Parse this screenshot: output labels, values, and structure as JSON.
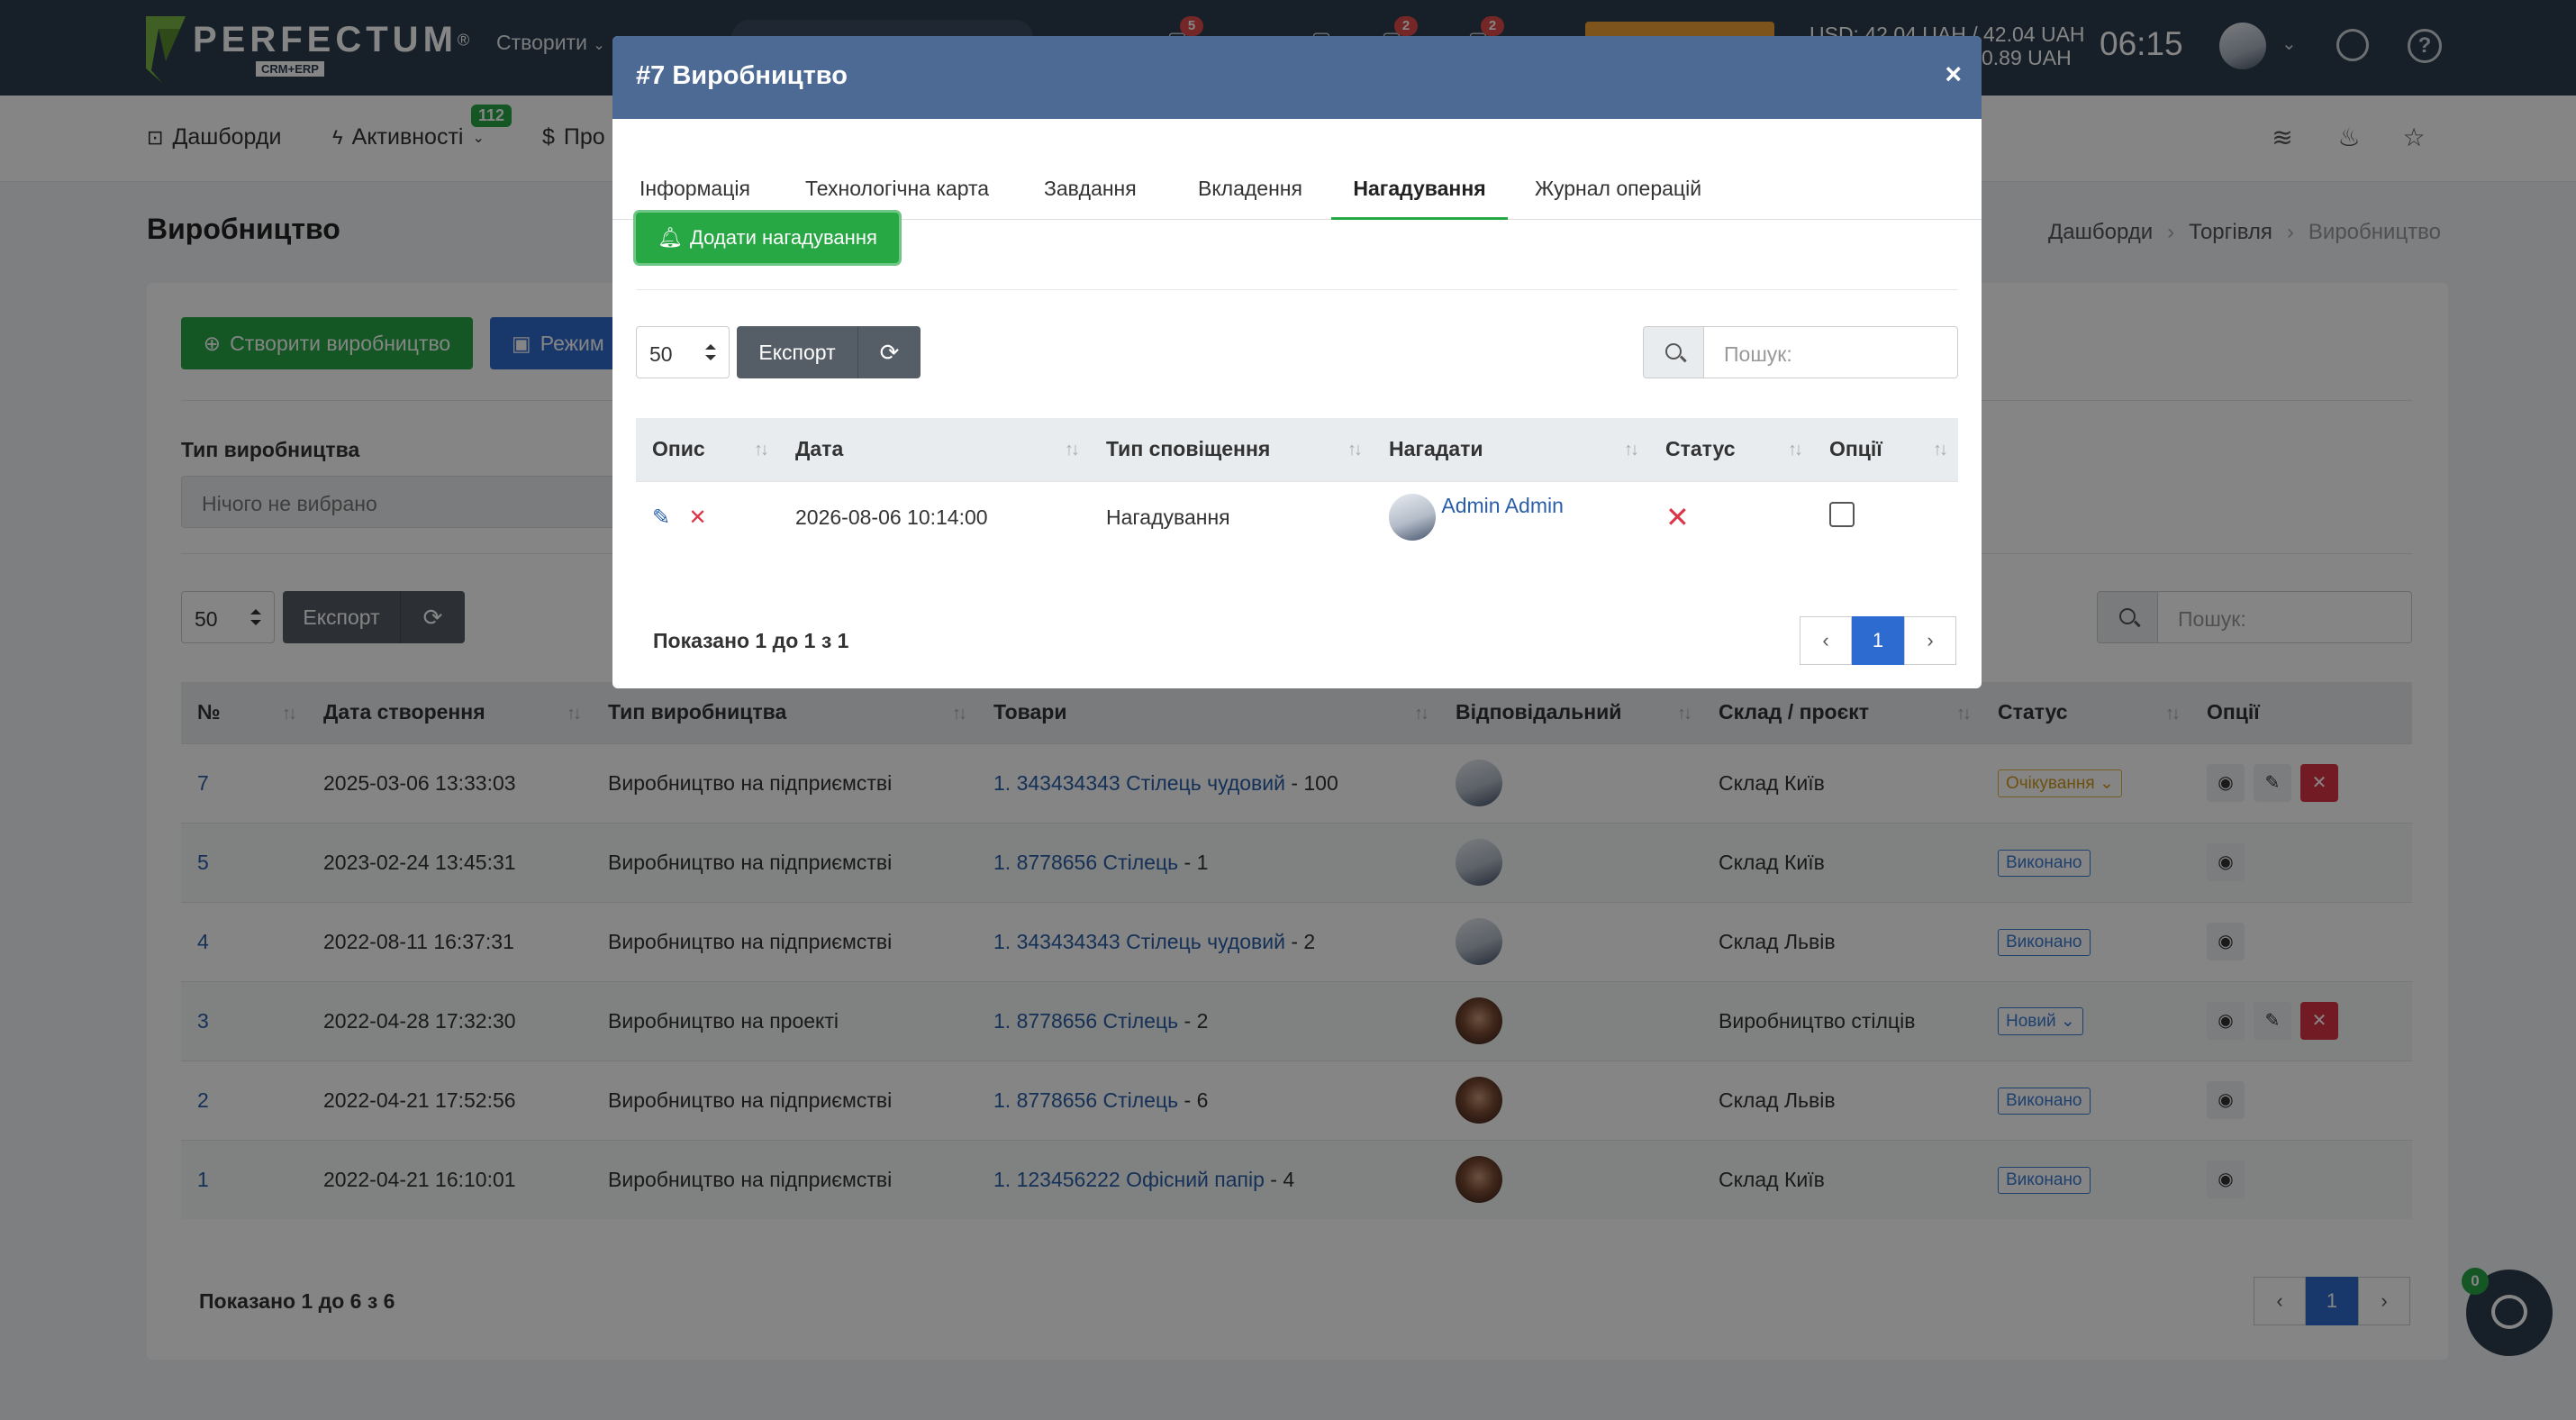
{
  "topbar": {
    "logo_name": "PERFECTUM",
    "logo_reg": "®",
    "logo_sub": "CRM+ERP",
    "create_label": "Створити",
    "badges": [
      "5",
      "2",
      "2"
    ],
    "rates_line1": "USD: 42.04 UAH / 42.04 UAH",
    "rates_line2": "0.89 UAH",
    "clock": "06:15"
  },
  "nav": {
    "items": [
      {
        "label": "Дашборди"
      },
      {
        "label": "Активності",
        "badge": "112"
      },
      {
        "label": "Про"
      }
    ]
  },
  "page": {
    "title": "Виробництво",
    "breadcrumb": [
      "Дашборди",
      "Торгівля",
      "Виробництво"
    ],
    "create_button": "Створити виробництво",
    "mode_button": "Режим",
    "filter_label": "Тип виробництва",
    "filter_placeholder": "Нічого не вибрано",
    "page_size": "50",
    "export_label": "Експорт",
    "search_placeholder": "Пошук:",
    "columns": [
      "№",
      "Дата створення",
      "Тип виробництва",
      "Товари",
      "Відповідальний",
      "Склад / проєкт",
      "Статус",
      "Опції"
    ],
    "rows": [
      {
        "id": "7",
        "date": "2025-03-06 13:33:03",
        "type": "Виробництво на підприємстві",
        "goods_link": "1. 343434343 Стілець чудовий",
        "goods_qty": " - 100",
        "avatar": "man",
        "warehouse": "Склад Київ",
        "status": "Очікування",
        "status_kind": "wait",
        "dropdown": true,
        "edit": true,
        "delete": true
      },
      {
        "id": "5",
        "date": "2023-02-24 13:45:31",
        "type": "Виробництво на підприємстві",
        "goods_link": "1. 8778656 Стілець",
        "goods_qty": " - 1",
        "avatar": "man",
        "warehouse": "Склад Київ",
        "status": "Виконано",
        "status_kind": "done",
        "dropdown": false,
        "edit": false,
        "delete": false
      },
      {
        "id": "4",
        "date": "2022-08-11 16:37:31",
        "type": "Виробництво на підприємстві",
        "goods_link": "1. 343434343 Стілець чудовий",
        "goods_qty": " - 2",
        "avatar": "man",
        "warehouse": "Склад Львів",
        "status": "Виконано",
        "status_kind": "done",
        "dropdown": false,
        "edit": false,
        "delete": false
      },
      {
        "id": "3",
        "date": "2022-04-28 17:32:30",
        "type": "Виробництво на проекті",
        "goods_link": "1. 8778656 Стілець",
        "goods_qty": " - 2",
        "avatar": "woman",
        "warehouse": "Виробництво стілців",
        "status": "Новий",
        "status_kind": "new",
        "dropdown": true,
        "edit": true,
        "delete": true
      },
      {
        "id": "2",
        "date": "2022-04-21 17:52:56",
        "type": "Виробництво на підприємстві",
        "goods_link": "1. 8778656 Стілець",
        "goods_qty": " - 6",
        "avatar": "woman",
        "warehouse": "Склад Львів",
        "status": "Виконано",
        "status_kind": "done",
        "dropdown": false,
        "edit": false,
        "delete": false
      },
      {
        "id": "1",
        "date": "2022-04-21 16:10:01",
        "type": "Виробництво на підприємстві",
        "goods_link": "1. 123456222 Офісний папір",
        "goods_qty": " - 4",
        "avatar": "woman",
        "warehouse": "Склад Київ",
        "status": "Виконано",
        "status_kind": "done",
        "dropdown": false,
        "edit": false,
        "delete": false
      }
    ],
    "shown_text": "Показано 1 до 6 з 6",
    "current_page": "1"
  },
  "modal": {
    "title": "#7 Виробництво",
    "close": "×",
    "tabs": [
      "Інформація",
      "Технологічна карта",
      "Завдання",
      "Вкладення",
      "Нагадування",
      "Журнал операцій"
    ],
    "active_tab": "Нагадування",
    "add_button": "Додати нагадування",
    "page_size": "50",
    "export_label": "Експорт",
    "search_placeholder": "Пошук:",
    "columns": [
      "Опис",
      "Дата",
      "Тип сповіщення",
      "Нагадати",
      "Статус",
      "Опції"
    ],
    "row": {
      "date": "2026-08-06 10:14:00",
      "type": "Нагадування",
      "person": "Admin Admin"
    },
    "shown_text": "Показано 1 до 1 з 1",
    "current_page": "1"
  },
  "chat": {
    "badge": "0"
  },
  "colors": {
    "green": "#28a745",
    "blue": "#2e6bd0",
    "topbar": "#2c3e50",
    "modal_header": "#4d6a95",
    "danger": "#dc3545"
  }
}
